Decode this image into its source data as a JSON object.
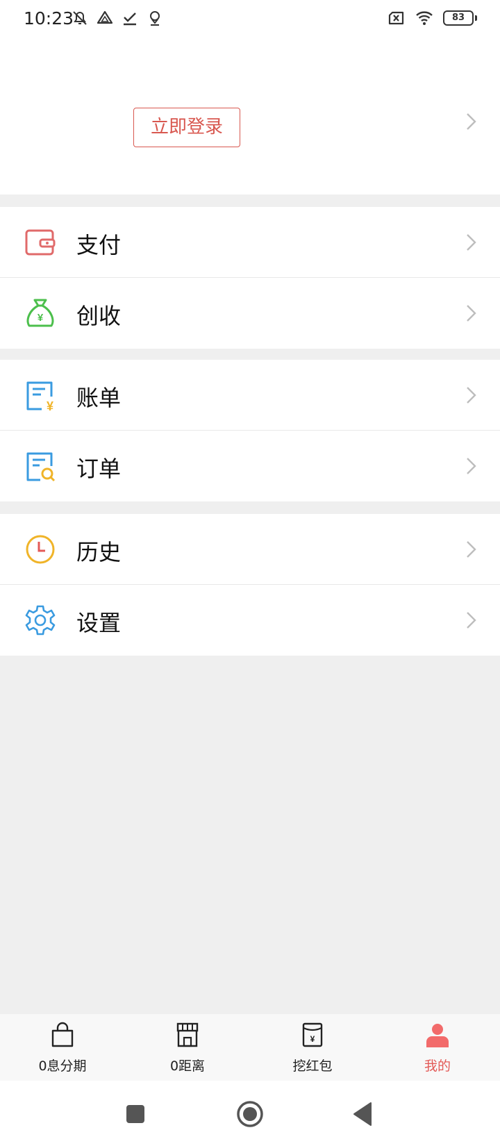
{
  "status_bar": {
    "time": "10:23",
    "battery": "83",
    "left_icons": [
      "mute-bell-icon",
      "drive-icon",
      "download-done-icon",
      "location-pin-icon"
    ],
    "right_icons": [
      "no-sim-icon",
      "wifi-icon",
      "battery-icon"
    ]
  },
  "login": {
    "button_label": "立即登录",
    "accent_color": "#d8574f"
  },
  "menu_sections": [
    [
      {
        "label": "支付",
        "icon": "wallet-icon"
      },
      {
        "label": "创收",
        "icon": "money-bag-icon"
      }
    ],
    [
      {
        "label": "账单",
        "icon": "bill-icon"
      },
      {
        "label": "订单",
        "icon": "order-search-icon"
      }
    ],
    [
      {
        "label": "历史",
        "icon": "clock-icon"
      },
      {
        "label": "设置",
        "icon": "gear-icon"
      }
    ]
  ],
  "tab_bar": {
    "active_index": 3,
    "active_color": "#e35a57",
    "tabs": [
      {
        "label": "0息分期",
        "icon": "shopping-bag-icon"
      },
      {
        "label": "0距离",
        "icon": "store-icon"
      },
      {
        "label": "挖红包",
        "icon": "red-envelope-icon"
      },
      {
        "label": "我的",
        "icon": "person-icon"
      }
    ]
  },
  "nav_bar": {
    "buttons": [
      "recent-apps-icon",
      "home-icon",
      "back-icon"
    ]
  }
}
